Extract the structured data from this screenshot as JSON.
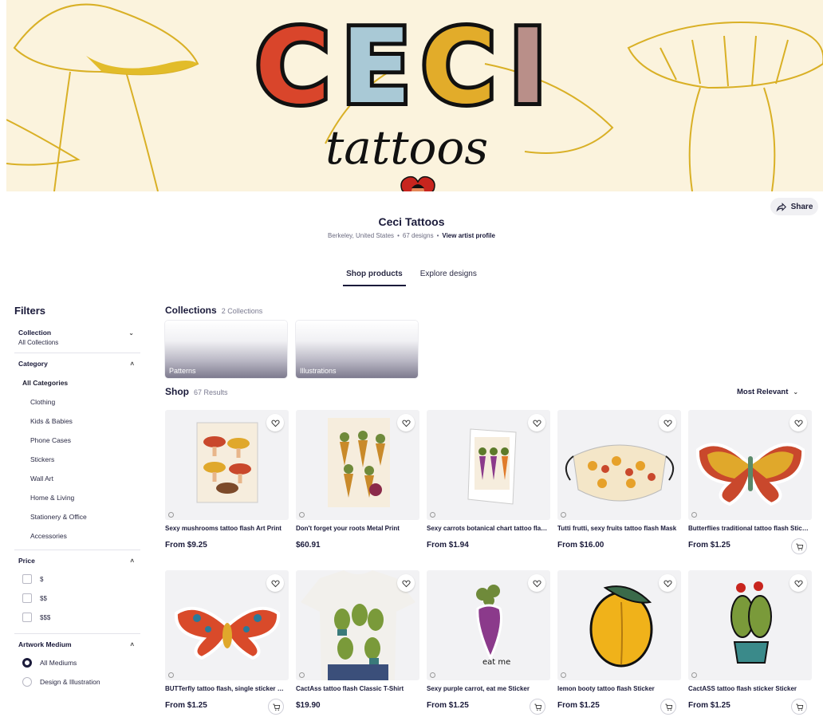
{
  "banner": {
    "logo_main": "CECI",
    "logo_sub": "tattoos",
    "colors": {
      "background": "#fbf3dd",
      "line": "#d9b026",
      "c1": "#d9452b",
      "e": "#a9c9d6",
      "c2": "#e2ac2a",
      "i": "#b98f89",
      "ink": "#111111"
    }
  },
  "share": {
    "label": "Share"
  },
  "artist": {
    "name": "Ceci Tattoos",
    "location": "Berkeley, United States",
    "designs": "67 designs",
    "profile_link": "View artist profile"
  },
  "tabs": [
    {
      "label": "Shop products",
      "active": true
    },
    {
      "label": "Explore designs",
      "active": false
    }
  ],
  "filters": {
    "title": "Filters",
    "collection": {
      "label": "Collection",
      "value": "All Collections"
    },
    "category": {
      "label": "Category",
      "all": "All Categories",
      "items": [
        "Clothing",
        "Kids & Babies",
        "Phone Cases",
        "Stickers",
        "Wall Art",
        "Home & Living",
        "Stationery & Office",
        "Accessories"
      ]
    },
    "price": {
      "label": "Price",
      "options": [
        "$",
        "$$",
        "$$$"
      ]
    },
    "medium": {
      "label": "Artwork Medium",
      "options": [
        "All Mediums",
        "Design & Illustration"
      ],
      "selected": "All Mediums"
    }
  },
  "collections": {
    "title": "Collections",
    "count": "2 Collections",
    "items": [
      "Patterns",
      "Illustrations"
    ]
  },
  "shop": {
    "title": "Shop",
    "count": "67 Results",
    "sort": "Most Relevant",
    "products": [
      {
        "title": "Sexy mushrooms tattoo flash Art Print",
        "price": "From $9.25",
        "cart": false,
        "icon": "mushrooms-print"
      },
      {
        "title": "Don't forget your roots Metal Print",
        "price": "$60.91",
        "cart": false,
        "icon": "roots-print"
      },
      {
        "title": "Sexy carrots botanical chart tattoo flash Greeting Card",
        "price": "From $1.94",
        "cart": false,
        "icon": "carrots-card"
      },
      {
        "title": "Tutti frutti, sexy fruits tattoo flash Mask",
        "price": "From $16.00",
        "cart": false,
        "icon": "fruit-mask"
      },
      {
        "title": "Butterflies traditional tattoo flash Sticker",
        "price": "From $1.25",
        "cart": true,
        "icon": "butterfly-sticker"
      },
      {
        "title": "BUTTerfly tattoo flash, single sticker Sticker",
        "price": "From $1.25",
        "cart": true,
        "icon": "moth-sticker"
      },
      {
        "title": "CactAss tattoo flash Classic T-Shirt",
        "price": "$19.90",
        "cart": false,
        "icon": "cactus-tshirt"
      },
      {
        "title": "Sexy purple carrot, eat me Sticker",
        "price": "From $1.25",
        "cart": true,
        "icon": "purple-carrot-sticker"
      },
      {
        "title": "lemon booty tattoo flash Sticker",
        "price": "From $1.25",
        "cart": true,
        "icon": "lemon-sticker"
      },
      {
        "title": "CactASS tattoo flash sticker Sticker",
        "price": "From $1.25",
        "cart": true,
        "icon": "cactus-sticker"
      }
    ]
  }
}
